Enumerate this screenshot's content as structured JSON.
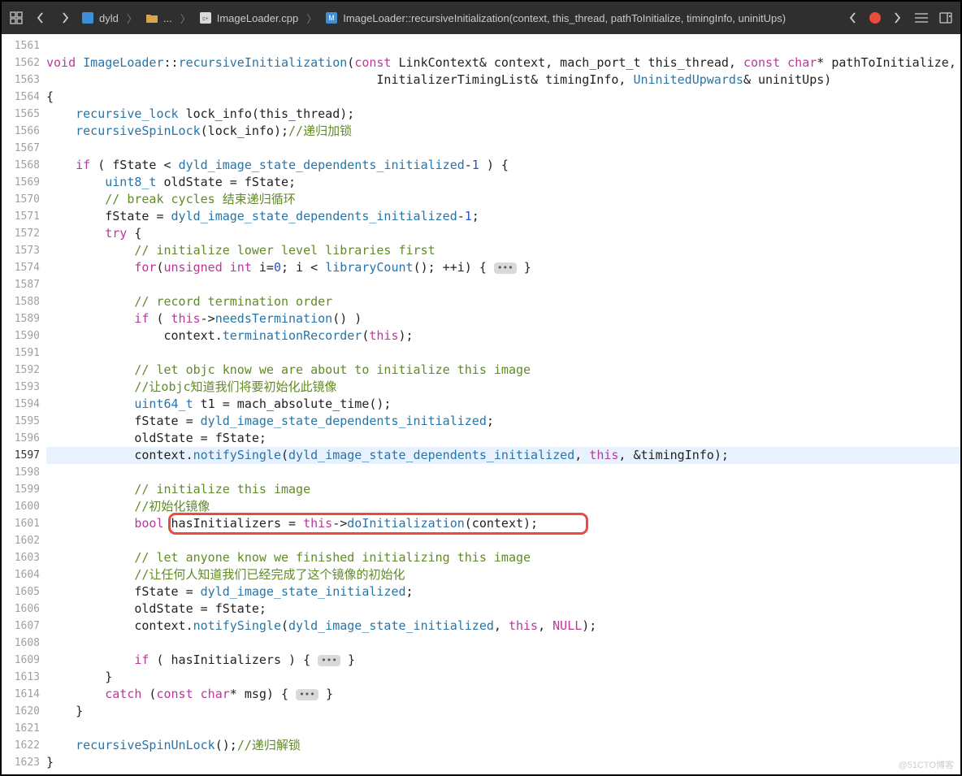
{
  "toolbar": {
    "crumb_project": "dyld",
    "crumb_ellipsis": "...",
    "crumb_file": "ImageLoader.cpp",
    "crumb_symbol": "ImageLoader::recursiveInitialization(context, this_thread, pathToInitialize, timingInfo, uninitUps)"
  },
  "gutter_numbers": [
    "1561",
    "1562",
    "1563",
    "1564",
    "1565",
    "1566",
    "1567",
    "1568",
    "1569",
    "1570",
    "1571",
    "1572",
    "1573",
    "1574",
    "1587",
    "1588",
    "1589",
    "1590",
    "1591",
    "1592",
    "1593",
    "1594",
    "1595",
    "1596",
    "1597",
    "1598",
    "1599",
    "1600",
    "1601",
    "1602",
    "1603",
    "1604",
    "1605",
    "1606",
    "1607",
    "1608",
    "1609",
    "1613",
    "1614",
    "1620",
    "1621",
    "1622",
    "1623"
  ],
  "current_line_index": 24,
  "code_rows": [
    {
      "ind": 0,
      "t": [
        [
          "",
          ""
        ]
      ]
    },
    {
      "ind": 0,
      "t": [
        [
          "kw",
          "void"
        ],
        [
          "plain",
          " "
        ],
        [
          "cls",
          "ImageLoader"
        ],
        [
          "plain",
          "::"
        ],
        [
          "fn",
          "recursiveInitialization"
        ],
        [
          "plain",
          "("
        ],
        [
          "kw",
          "const"
        ],
        [
          "plain",
          " LinkContext& context, mach_port_t this_thread, "
        ],
        [
          "kw",
          "const"
        ],
        [
          "plain",
          " "
        ],
        [
          "kw",
          "char"
        ],
        [
          "plain",
          "* pathToInitialize,"
        ]
      ]
    },
    {
      "ind": 0,
      "t": [
        [
          "plain",
          "                                             InitializerTimingList& timingInfo, "
        ],
        [
          "cls",
          "UninitedUpwards"
        ],
        [
          "plain",
          "& uninitUps)"
        ]
      ]
    },
    {
      "ind": 0,
      "t": [
        [
          "plain",
          "{"
        ]
      ]
    },
    {
      "ind": 1,
      "t": [
        [
          "cls",
          "recursive_lock"
        ],
        [
          "plain",
          " lock_info(this_thread);"
        ]
      ]
    },
    {
      "ind": 1,
      "t": [
        [
          "fn",
          "recursiveSpinLock"
        ],
        [
          "plain",
          "(lock_info);"
        ],
        [
          "cmt",
          "//递归加锁"
        ]
      ]
    },
    {
      "ind": 0,
      "t": [
        [
          "",
          ""
        ]
      ]
    },
    {
      "ind": 1,
      "t": [
        [
          "kw",
          "if"
        ],
        [
          "plain",
          " ( fState < "
        ],
        [
          "id2",
          "dyld_image_state_dependents_initialized"
        ],
        [
          "plain",
          "-"
        ],
        [
          "num",
          "1"
        ],
        [
          "plain",
          " ) {"
        ]
      ]
    },
    {
      "ind": 2,
      "t": [
        [
          "cls",
          "uint8_t"
        ],
        [
          "plain",
          " oldState = fState;"
        ]
      ]
    },
    {
      "ind": 2,
      "t": [
        [
          "cmt",
          "// break cycles 结束递归循环"
        ]
      ]
    },
    {
      "ind": 2,
      "t": [
        [
          "plain",
          "fState = "
        ],
        [
          "id2",
          "dyld_image_state_dependents_initialized"
        ],
        [
          "plain",
          "-"
        ],
        [
          "num",
          "1"
        ],
        [
          "plain",
          ";"
        ]
      ]
    },
    {
      "ind": 2,
      "t": [
        [
          "kw",
          "try"
        ],
        [
          "plain",
          " {"
        ]
      ]
    },
    {
      "ind": 3,
      "t": [
        [
          "cmt",
          "// initialize lower level libraries first"
        ]
      ]
    },
    {
      "ind": 3,
      "t": [
        [
          "kw",
          "for"
        ],
        [
          "plain",
          "("
        ],
        [
          "kw",
          "unsigned"
        ],
        [
          "plain",
          " "
        ],
        [
          "kw",
          "int"
        ],
        [
          "plain",
          " i="
        ],
        [
          "num",
          "0"
        ],
        [
          "plain",
          "; i < "
        ],
        [
          "fn",
          "libraryCount"
        ],
        [
          "plain",
          "(); ++i) { "
        ],
        [
          "fold",
          "•••"
        ],
        [
          "plain",
          " }"
        ]
      ]
    },
    {
      "ind": 0,
      "t": [
        [
          "",
          ""
        ]
      ]
    },
    {
      "ind": 3,
      "t": [
        [
          "cmt",
          "// record termination order"
        ]
      ]
    },
    {
      "ind": 3,
      "t": [
        [
          "kw",
          "if"
        ],
        [
          "plain",
          " ( "
        ],
        [
          "this",
          "this"
        ],
        [
          "plain",
          "->"
        ],
        [
          "fn",
          "needsTermination"
        ],
        [
          "plain",
          "() )"
        ]
      ]
    },
    {
      "ind": 4,
      "t": [
        [
          "plain",
          "context."
        ],
        [
          "fn",
          "terminationRecorder"
        ],
        [
          "plain",
          "("
        ],
        [
          "this",
          "this"
        ],
        [
          "plain",
          ");"
        ]
      ]
    },
    {
      "ind": 0,
      "t": [
        [
          "",
          ""
        ]
      ]
    },
    {
      "ind": 3,
      "t": [
        [
          "cmt",
          "// let objc know we are about to initialize this image"
        ]
      ]
    },
    {
      "ind": 3,
      "t": [
        [
          "cmt",
          "//让objc知道我们将要初始化此镜像"
        ]
      ]
    },
    {
      "ind": 3,
      "t": [
        [
          "cls",
          "uint64_t"
        ],
        [
          "plain",
          " t1 = mach_absolute_time();"
        ]
      ]
    },
    {
      "ind": 3,
      "t": [
        [
          "plain",
          "fState = "
        ],
        [
          "id2",
          "dyld_image_state_dependents_initialized"
        ],
        [
          "plain",
          ";"
        ]
      ]
    },
    {
      "ind": 3,
      "t": [
        [
          "plain",
          "oldState = fState;"
        ]
      ]
    },
    {
      "ind": 3,
      "hl": true,
      "t": [
        [
          "plain",
          "context."
        ],
        [
          "fn",
          "notifySingle"
        ],
        [
          "plain",
          "("
        ],
        [
          "id2",
          "dyld_image_state_dependents_initialized"
        ],
        [
          "plain",
          ", "
        ],
        [
          "this",
          "this"
        ],
        [
          "plain",
          ", &timingInfo);"
        ]
      ]
    },
    {
      "ind": 0,
      "t": [
        [
          "",
          ""
        ]
      ]
    },
    {
      "ind": 3,
      "t": [
        [
          "cmt",
          "// initialize this image"
        ]
      ]
    },
    {
      "ind": 3,
      "t": [
        [
          "cmt",
          "//初始化镜像"
        ]
      ]
    },
    {
      "ind": 3,
      "box": true,
      "t": [
        [
          "kw",
          "bool"
        ],
        [
          "plain",
          " hasInitializers = "
        ],
        [
          "this",
          "this"
        ],
        [
          "plain",
          "->"
        ],
        [
          "fn",
          "doInitialization"
        ],
        [
          "plain",
          "(context);"
        ]
      ]
    },
    {
      "ind": 0,
      "t": [
        [
          "",
          ""
        ]
      ]
    },
    {
      "ind": 3,
      "t": [
        [
          "cmt",
          "// let anyone know we finished initializing this image"
        ]
      ]
    },
    {
      "ind": 3,
      "t": [
        [
          "cmt",
          "//让任何人知道我们已经完成了这个镜像的初始化"
        ]
      ]
    },
    {
      "ind": 3,
      "t": [
        [
          "plain",
          "fState = "
        ],
        [
          "id2",
          "dyld_image_state_initialized"
        ],
        [
          "plain",
          ";"
        ]
      ]
    },
    {
      "ind": 3,
      "t": [
        [
          "plain",
          "oldState = fState;"
        ]
      ]
    },
    {
      "ind": 3,
      "t": [
        [
          "plain",
          "context."
        ],
        [
          "fn",
          "notifySingle"
        ],
        [
          "plain",
          "("
        ],
        [
          "id2",
          "dyld_image_state_initialized"
        ],
        [
          "plain",
          ", "
        ],
        [
          "this",
          "this"
        ],
        [
          "plain",
          ", "
        ],
        [
          "kw",
          "NULL"
        ],
        [
          "plain",
          ");"
        ]
      ]
    },
    {
      "ind": 0,
      "t": [
        [
          "",
          ""
        ]
      ]
    },
    {
      "ind": 3,
      "t": [
        [
          "kw",
          "if"
        ],
        [
          "plain",
          " ( hasInitializers ) { "
        ],
        [
          "fold",
          "•••"
        ],
        [
          "plain",
          " }"
        ]
      ]
    },
    {
      "ind": 2,
      "t": [
        [
          "plain",
          "}"
        ]
      ]
    },
    {
      "ind": 2,
      "t": [
        [
          "kw",
          "catch"
        ],
        [
          "plain",
          " ("
        ],
        [
          "kw",
          "const"
        ],
        [
          "plain",
          " "
        ],
        [
          "kw",
          "char"
        ],
        [
          "plain",
          "* msg) { "
        ],
        [
          "fold",
          "•••"
        ],
        [
          "plain",
          " }"
        ]
      ]
    },
    {
      "ind": 1,
      "t": [
        [
          "plain",
          "}"
        ]
      ]
    },
    {
      "ind": 0,
      "t": [
        [
          "",
          ""
        ]
      ]
    },
    {
      "ind": 1,
      "t": [
        [
          "fn",
          "recursiveSpinUnLock"
        ],
        [
          "plain",
          "();"
        ],
        [
          "cmt",
          "//递归解锁"
        ]
      ]
    },
    {
      "ind": 0,
      "t": [
        [
          "plain",
          "}"
        ]
      ]
    }
  ],
  "watermark": "@51CTO博客"
}
